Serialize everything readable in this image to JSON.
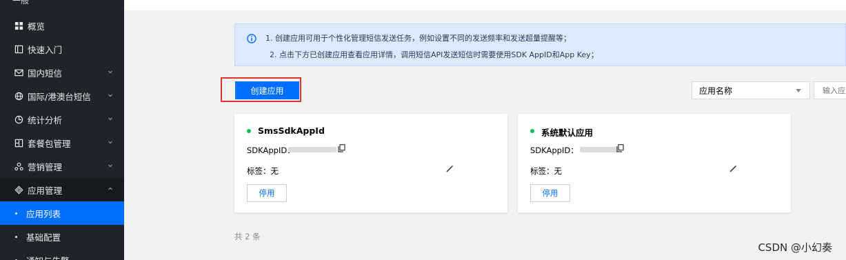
{
  "sidebar": {
    "top_fragment": "一般",
    "items": [
      {
        "label": "概览",
        "icon": "grid-icon"
      },
      {
        "label": "快速入门",
        "icon": "book-icon"
      },
      {
        "label": "国内短信",
        "icon": "mail-icon"
      },
      {
        "label": "国际/港澳台短信",
        "icon": "globe-icon"
      },
      {
        "label": "统计分析",
        "icon": "chart-icon"
      },
      {
        "label": "套餐包管理",
        "icon": "package-icon"
      },
      {
        "label": "营销管理",
        "icon": "people-icon"
      },
      {
        "label": "应用管理",
        "icon": "diamond-icon"
      }
    ],
    "subitems": [
      {
        "label": "应用列表"
      },
      {
        "label": "基础配置"
      },
      {
        "label": "通知与告警"
      }
    ]
  },
  "notice": {
    "line1": "1. 创建应用可用于个性化管理短信发送任务，例如设置不同的发送频率和发送超量提醒等；",
    "line2": "2. 点击下方已创建应用查看应用详情，调用短信API发送短信时需要使用SDK AppID和App Key；"
  },
  "toolbar": {
    "create_label": "创建应用",
    "filter_selected": "应用名称",
    "search_placeholder": "输入应用"
  },
  "apps": [
    {
      "name": "SmsSdkAppId",
      "sdk_label": "SDKAppID：",
      "tag_label": "标签：无",
      "disable_label": "停用",
      "status_color": "#0abf5b"
    },
    {
      "name": "系统默认应用",
      "sdk_label": "SDKAppID：",
      "tag_label": "标签：无",
      "disable_label": "停用",
      "status_color": "#0abf5b"
    }
  ],
  "total_text": "共 2 条",
  "watermark": "CSDN @小幻奏",
  "colors": {
    "sidebar_bg": "#20232a",
    "accent": "#006eff",
    "highlight": "#e3312d",
    "notice_bg": "#dde9ff"
  }
}
